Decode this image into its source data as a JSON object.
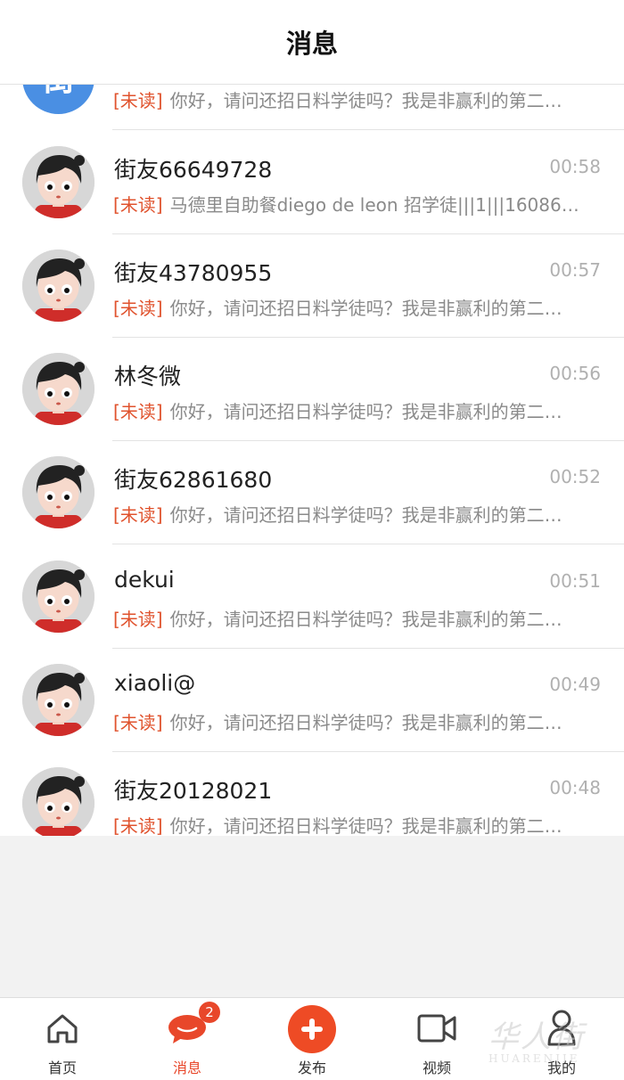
{
  "header": {
    "title": "消息"
  },
  "messages": [
    {
      "name": "",
      "avatar_char": "街",
      "avatar_color": "#4a8fe3",
      "time": "",
      "tag": "[未读]",
      "preview": "你好，请问还招日料学徒吗？我是非赢利的第二…"
    },
    {
      "name": "街友66649728",
      "time": "00:58",
      "tag": "[未读]",
      "preview": "马德里自助餐diego de leon 招学徒|||1|||16086…"
    },
    {
      "name": "街友43780955",
      "time": "00:57",
      "tag": "[未读]",
      "preview": "你好，请问还招日料学徒吗？我是非赢利的第二…"
    },
    {
      "name": "林冬微",
      "time": "00:56",
      "tag": "[未读]",
      "preview": "你好，请问还招日料学徒吗？我是非赢利的第二…"
    },
    {
      "name": "街友62861680",
      "time": "00:52",
      "tag": "[未读]",
      "preview": "你好，请问还招日料学徒吗？我是非赢利的第二…"
    },
    {
      "name": "dekui",
      "time": "00:51",
      "tag": "[未读]",
      "preview": "你好，请问还招日料学徒吗？我是非赢利的第二…"
    },
    {
      "name": "xiaoli@",
      "time": "00:49",
      "tag": "[未读]",
      "preview": "你好，请问还招日料学徒吗？我是非赢利的第二…"
    },
    {
      "name": "街友20128021",
      "time": "00:48",
      "tag": "[未读]",
      "preview": "你好，请问还招日料学徒吗？我是非赢利的第二…"
    }
  ],
  "tabbar": {
    "home": {
      "label": "首页",
      "icon": "home-icon"
    },
    "messages": {
      "label": "消息",
      "icon": "chat-bubble-icon",
      "badge": "2"
    },
    "publish": {
      "label": "发布",
      "icon": "plus-icon"
    },
    "video": {
      "label": "视频",
      "icon": "video-camera-icon"
    },
    "me": {
      "label": "我的",
      "icon": "user-icon"
    }
  },
  "watermark": {
    "cn": "华人街",
    "en": "HUARENJIE"
  },
  "colors": {
    "accent": "#e8472a",
    "unread_tag": "#e0532e",
    "avatar_blue": "#4a8fe3"
  }
}
